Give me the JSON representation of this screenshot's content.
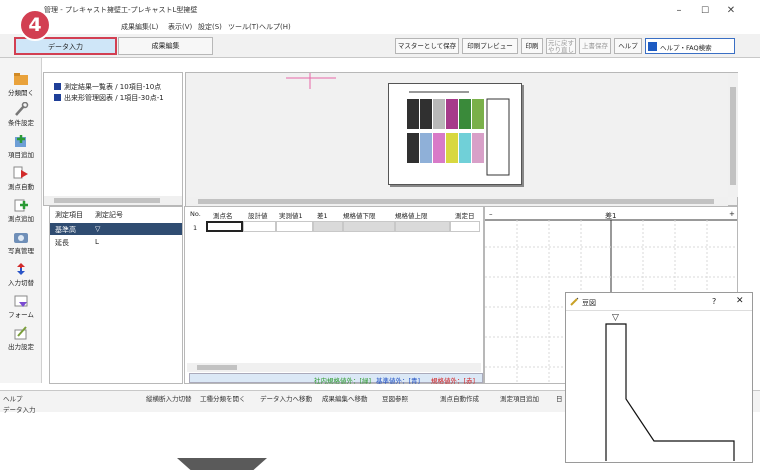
{
  "window": {
    "title": "管理 - プレキャスト擁壁工-プレキャストL型擁壁",
    "minimize": "–",
    "maximize": "☐",
    "close": "✕"
  },
  "step_badge": "4",
  "menu": {
    "items": [
      "成果編集(L)",
      "表示(V)",
      "設定(S)",
      "ツール(T)",
      "ヘルプ(H)"
    ]
  },
  "ribbon": {
    "tabs": [
      {
        "label": "データ入力",
        "active": true
      },
      {
        "label": "成果編集",
        "active": false
      }
    ],
    "buttons": {
      "master_save": "マスターとして保存",
      "print_preview": "印刷プレビュー",
      "print": "印刷",
      "undo": "元に戻す",
      "redo": "やり直し",
      "overwrite_save": "上書保存",
      "help": "ヘルプ"
    },
    "help_search": "ヘルプ・FAQ検索"
  },
  "left_toolbar": [
    {
      "label": "分類開く",
      "icon": "folder-icon"
    },
    {
      "label": "条件設定",
      "icon": "wrench-icon"
    },
    {
      "label": "項目追加",
      "icon": "add-item-icon"
    },
    {
      "label": "測点自動",
      "icon": "auto-point-icon"
    },
    {
      "label": "測点追加",
      "icon": "add-point-icon"
    },
    {
      "label": "写真管理",
      "icon": "camera-icon"
    },
    {
      "label": "入力切替",
      "icon": "switch-icon"
    },
    {
      "label": "フォーム",
      "icon": "form-icon"
    },
    {
      "label": "出力設定",
      "icon": "output-icon"
    }
  ],
  "tree": [
    "測定結果一覧表 / 10項目-10点",
    "出来形管理図表 / 1項目-30点-1"
  ],
  "items_panel": {
    "header_item": "測定項目",
    "header_symbol": "測定記号",
    "rows": [
      {
        "item": "基準高",
        "symbol": "▽",
        "selected": true
      },
      {
        "item": "延長",
        "symbol": "L",
        "selected": false
      }
    ]
  },
  "grid": {
    "headers": [
      "No.",
      "測点名",
      "設計値",
      "実測値1",
      "差1",
      "規格値下限",
      "規格値上限",
      "測定日"
    ],
    "row_no": "1",
    "status_parts": [
      {
        "text": "社内規格値外：[緑]",
        "color": "#2e9a2e"
      },
      {
        "text": "基準値外：[青]",
        "color": "#1d4fc4"
      },
      {
        "text": "規格値外：[赤]",
        "color": "#d22020"
      }
    ]
  },
  "chart": {
    "minus": "–",
    "title": "差1",
    "plus": "+"
  },
  "statusbar": {
    "fkeys": [
      "ヘルプ",
      "",
      "縦横断入力切替",
      "工種分類を開く",
      "データ入力へ移動",
      "成果編集へ移動",
      "豆図参照",
      "測点自動作成",
      "測定項目追加",
      "日"
    ],
    "mode": "データ入力"
  },
  "dialog": {
    "title": "豆図",
    "help": "?",
    "close": "✕",
    "marker": "▽"
  }
}
